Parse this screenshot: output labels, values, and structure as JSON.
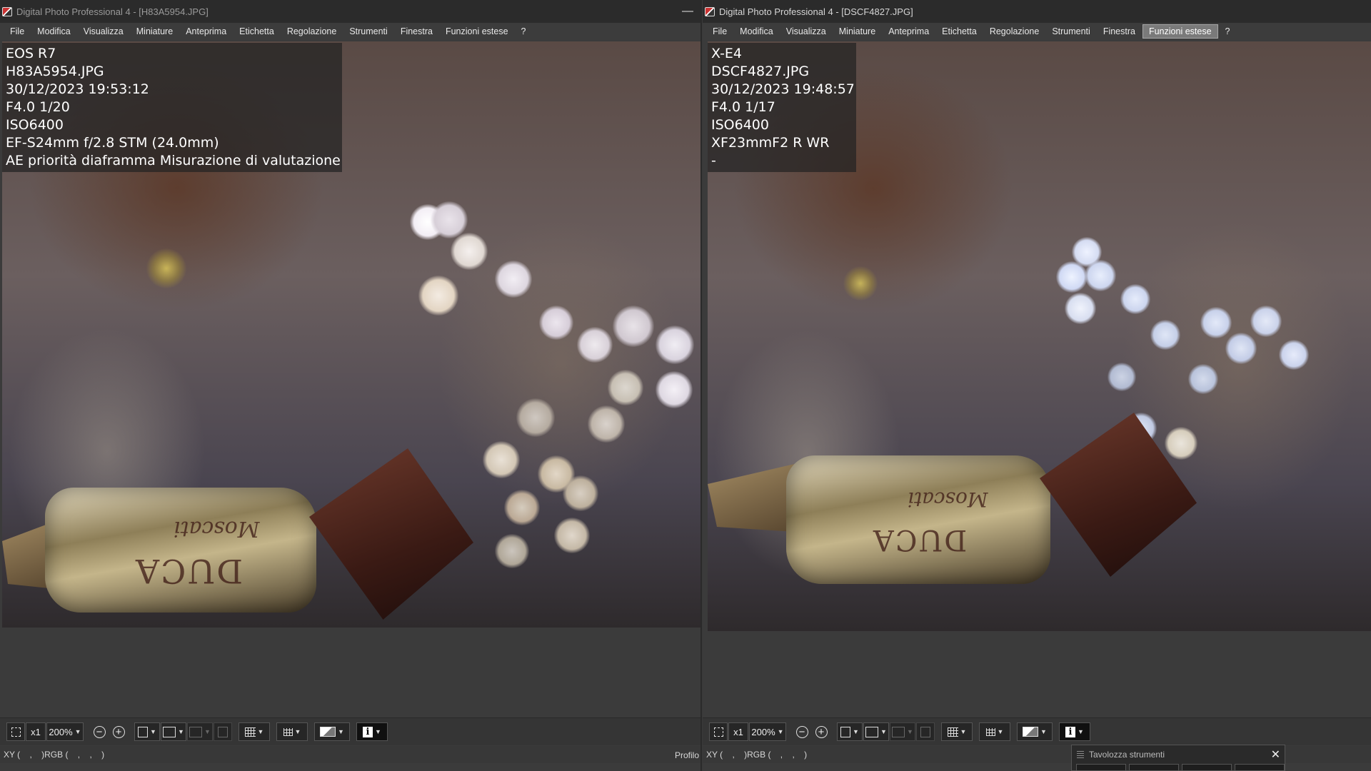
{
  "left": {
    "title": "Digital Photo Professional 4 - [H83A5954.JPG]",
    "menu": [
      "File",
      "Modifica",
      "Visualizza",
      "Miniature",
      "Anteprima",
      "Etichetta",
      "Regolazione",
      "Strumenti",
      "Finestra",
      "Funzioni estese",
      "?"
    ],
    "info": {
      "camera": "EOS R7",
      "file": "H83A5954.JPG",
      "datetime": "30/12/2023 19:53:12",
      "exposure": "F4.0 1/20",
      "iso": "ISO6400",
      "lens": "EF-S24mm f/2.8 STM (24.0mm)",
      "mode": "AE priorità diaframma Misurazione di valutazione"
    },
    "toolbar": {
      "zoom_x1": "x1",
      "zoom": "200%"
    },
    "status": "XY (    ,    )RGB (    ,    ,    )",
    "profile": "Profilo"
  },
  "right": {
    "title": "Digital Photo Professional 4 - [DSCF4827.JPG]",
    "menu": [
      "File",
      "Modifica",
      "Visualizza",
      "Miniature",
      "Anteprima",
      "Etichetta",
      "Regolazione",
      "Strumenti",
      "Finestra",
      "Funzioni estese",
      "?"
    ],
    "active_menu": "Funzioni estese",
    "info": {
      "camera": "X-E4",
      "file": "DSCF4827.JPG",
      "datetime": "30/12/2023 19:48:57",
      "exposure": "F4.0 1/17",
      "iso": "ISO6400",
      "lens": "XF23mmF2 R WR",
      "mode": "-"
    },
    "toolbar": {
      "zoom_x1": "x1",
      "zoom": "200%"
    },
    "status": "XY (    ,    )RGB (    ,    ,    )"
  },
  "palette": {
    "title": "Tavolozza strumenti"
  },
  "photo": {
    "left_candy_text": "DUCA",
    "left_candy_script": "Moscati",
    "right_candy_text": "DUCA",
    "right_candy_script": "Moscati"
  },
  "icons": {
    "fit": "fit-window-icon",
    "zoom_out": "zoom-out-icon",
    "zoom_in": "zoom-in-icon",
    "info": "info-icon",
    "close": "close-icon"
  }
}
